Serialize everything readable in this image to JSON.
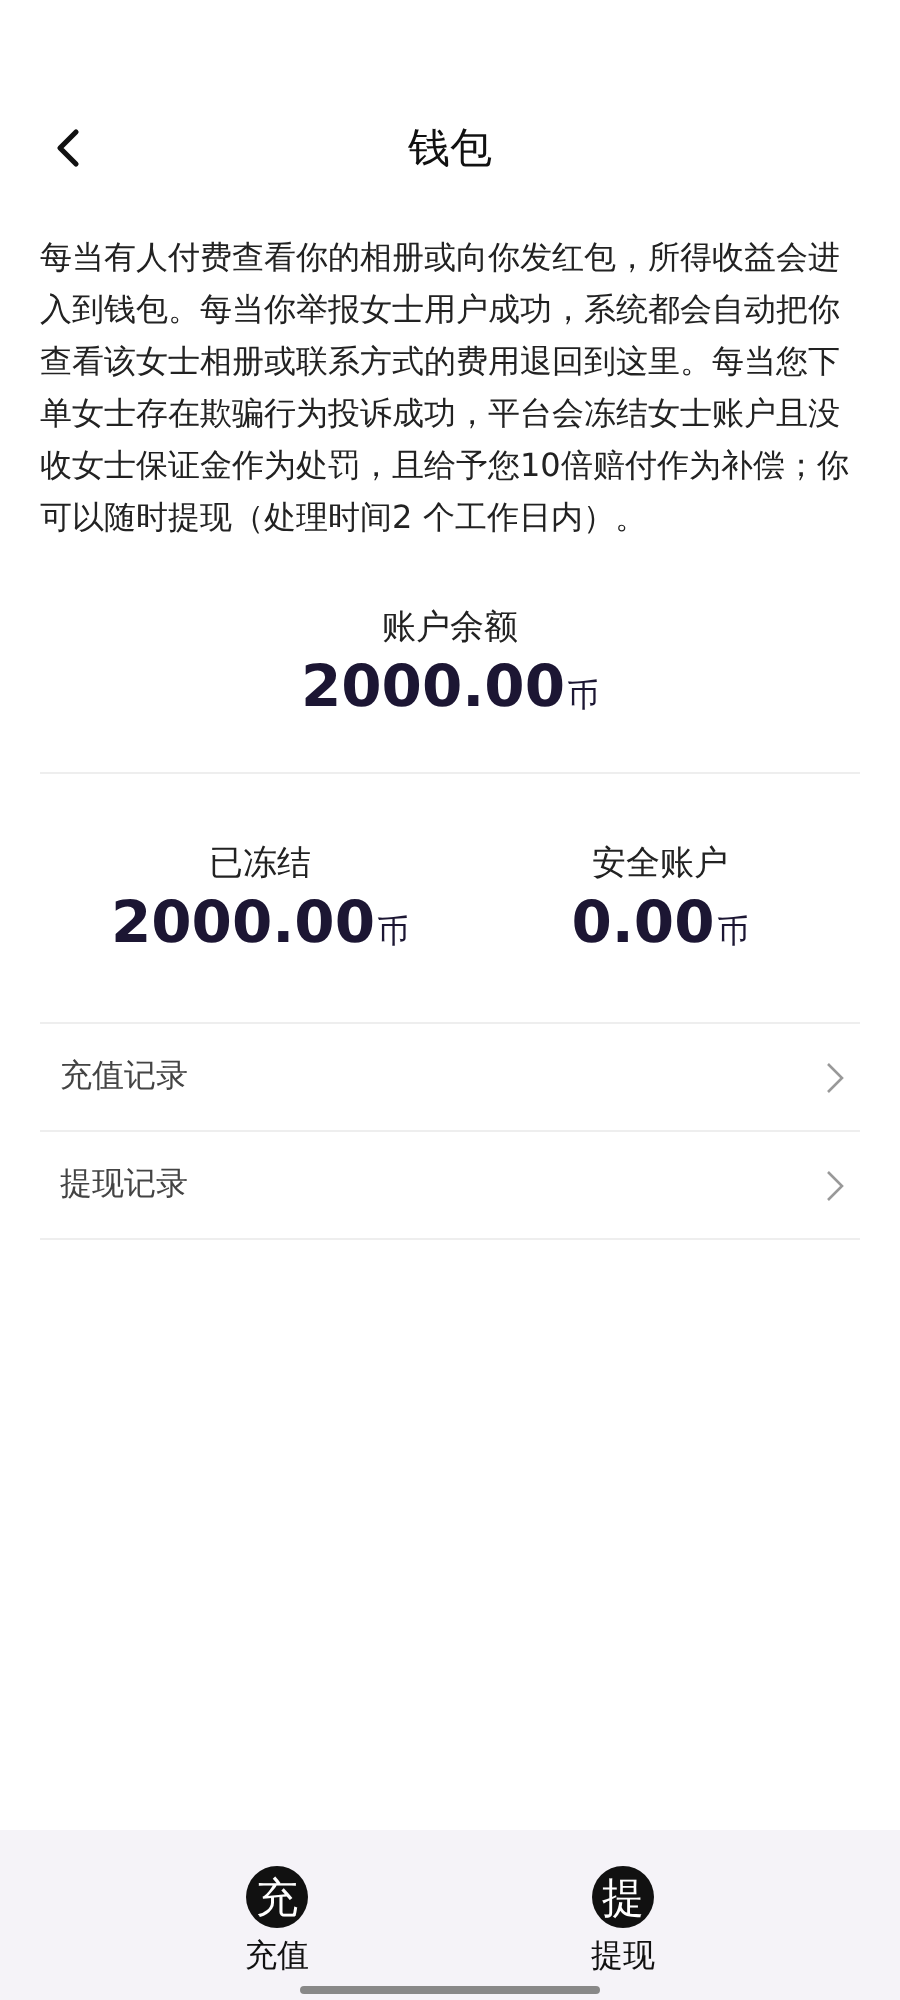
{
  "header": {
    "title": "钱包"
  },
  "description": "每当有人付费查看你的相册或向你发红包，所得收益会进入到钱包。每当你举报女士用户成功，系统都会自动把你查看该女士相册或联系方式的费用退回到这里。每当您下单女士存在欺骗行为投诉成功，平台会冻结女士账户且没收女士保证金作为处罚，且给予您10倍赔付作为补偿；你可以随时提现（处理时间2 个工作日内）。",
  "balance": {
    "label": "账户余额",
    "amount": "2000.00",
    "unit": "币"
  },
  "stats": [
    {
      "label": "已冻结",
      "amount": "2000.00",
      "unit": "币"
    },
    {
      "label": "安全账户",
      "amount": "0.00",
      "unit": "币"
    }
  ],
  "records": [
    {
      "label": "充值记录"
    },
    {
      "label": "提现记录"
    }
  ],
  "actions": [
    {
      "icon_char": "充",
      "label": "充值"
    },
    {
      "icon_char": "提",
      "label": "提现"
    }
  ]
}
